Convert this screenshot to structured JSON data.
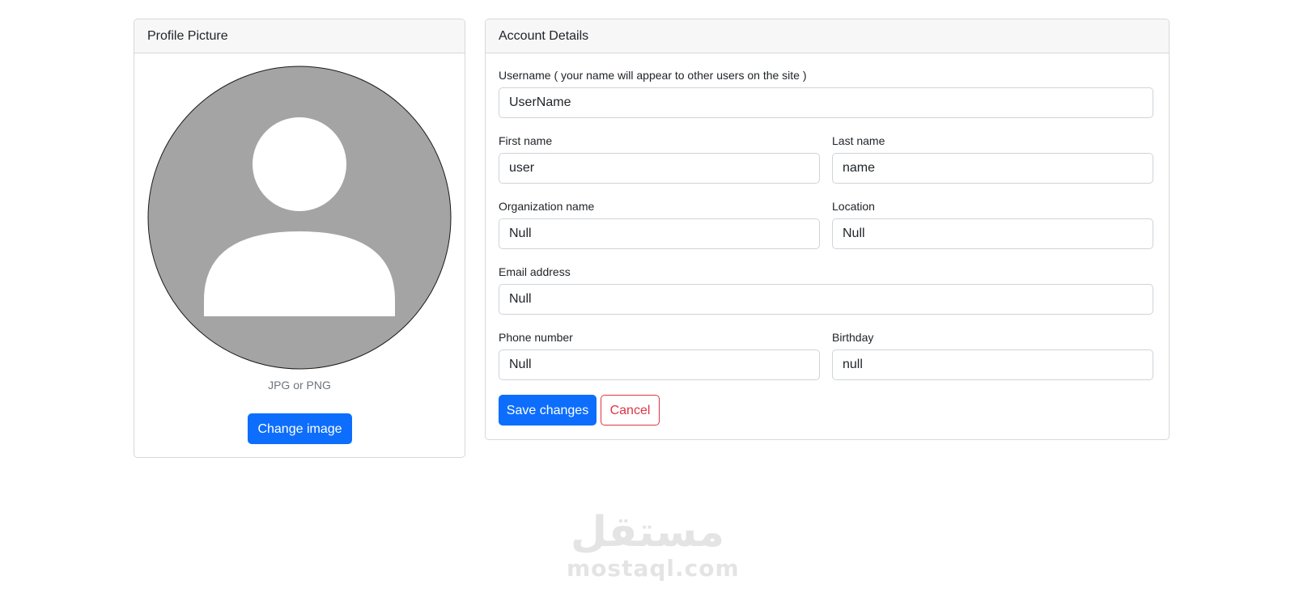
{
  "profile": {
    "header": "Profile Picture",
    "hint": "JPG or PNG",
    "change_label": "Change image"
  },
  "account": {
    "header": "Account Details",
    "username_label": "Username ( your name will appear to other users on the site )",
    "username_value": "UserName",
    "first_name_label": "First name",
    "first_name_value": "user",
    "last_name_label": "Last name",
    "last_name_value": "name",
    "org_label": "Organization name",
    "org_value": "Null",
    "location_label": "Location",
    "location_value": "Null",
    "email_label": "Email address",
    "email_value": "Null",
    "phone_label": "Phone number",
    "phone_value": "Null",
    "birthday_label": "Birthday",
    "birthday_value": "null",
    "save_label": "Save changes",
    "cancel_label": "Cancel"
  },
  "watermark": {
    "logo_text": "مستقل",
    "site_text": "mostaql.com"
  },
  "colors": {
    "primary": "#0d6efd",
    "danger": "#dc3545",
    "avatar_bg": "#a4a4a4",
    "header_bg": "#f7f7f7",
    "muted_text": "#6c757d"
  }
}
